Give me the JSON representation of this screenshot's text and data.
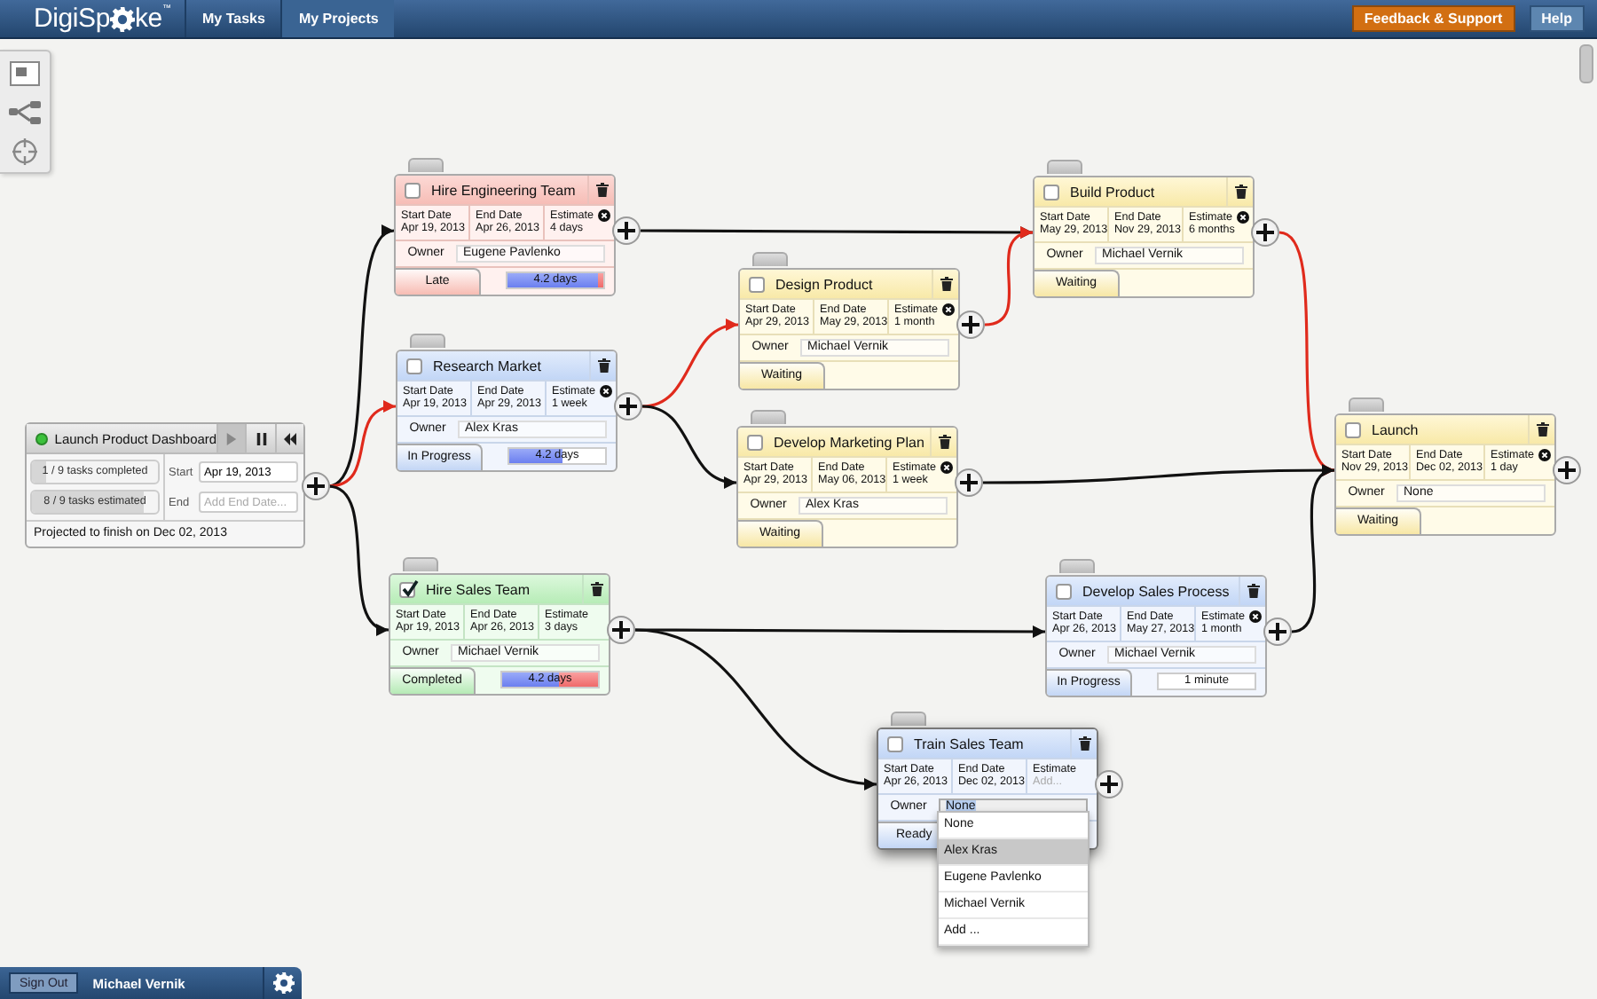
{
  "topbar": {
    "logo": {
      "parts": [
        "DigiSp",
        "ke"
      ],
      "mark": "™"
    },
    "tabs": [
      {
        "label": "My Tasks",
        "selected": false
      },
      {
        "label": "My Projects",
        "selected": true
      }
    ],
    "buttons": [
      {
        "label": "Feedback & Support",
        "kind": "feedback"
      },
      {
        "label": "Help",
        "kind": "help"
      }
    ]
  },
  "dashboard": {
    "title": "Launch Product Dashboard",
    "running": true,
    "controls": [
      {
        "kind": "play",
        "disabled": true
      },
      {
        "kind": "pause",
        "disabled": false
      },
      {
        "kind": "rewind",
        "disabled": false
      }
    ],
    "counters": [
      {
        "label": "1 / 9 tasks completed",
        "level": 0.11
      },
      {
        "label": "8 / 9 tasks estimated",
        "level": 0.89
      }
    ],
    "start": {
      "label": "Start",
      "value": "Apr 19, 2013"
    },
    "end": {
      "label": "End",
      "placeholder": "Add End Date..."
    },
    "projection": "Projected to finish on Dec 02, 2013",
    "links": [
      {
        "critical": false
      },
      {
        "critical": true
      },
      {
        "critical": false
      }
    ]
  },
  "tasks": [
    {
      "title": "Hire Engineering Team",
      "done": false,
      "focused": false,
      "dates": [
        {
          "label": "Start Date",
          "value": "Apr 19, 2013"
        },
        {
          "label": "End Date",
          "value": "Apr 26, 2013"
        },
        {
          "label": "Estimate",
          "value": "4 days",
          "clearable": true
        }
      ],
      "owner": {
        "label": "Owner",
        "value": "Eugene Pavlenko"
      },
      "status": {
        "label": "Late",
        "kind": "late"
      },
      "progress": {
        "label": "4.2 days",
        "level": 0.95,
        "overdue": true
      },
      "links": [
        {
          "critical": false
        }
      ]
    },
    {
      "title": "Research Market",
      "done": false,
      "focused": false,
      "dates": [
        {
          "label": "Start Date",
          "value": "Apr 19, 2013"
        },
        {
          "label": "End Date",
          "value": "Apr 29, 2013"
        },
        {
          "label": "Estimate",
          "value": "1 week",
          "clearable": true
        }
      ],
      "owner": {
        "label": "Owner",
        "value": "Alex Kras"
      },
      "status": {
        "label": "In Progress",
        "kind": "in-progress"
      },
      "progress": {
        "label": "4.2 days",
        "level": 0.55,
        "overdue": false
      },
      "links": [
        {
          "critical": true
        },
        {
          "critical": false
        }
      ]
    },
    {
      "title": "Hire Sales Team",
      "done": true,
      "focused": false,
      "dates": [
        {
          "label": "Start Date",
          "value": "Apr 19, 2013"
        },
        {
          "label": "End Date",
          "value": "Apr 26, 2013"
        },
        {
          "label": "Estimate",
          "value": "3 days",
          "clearable": false
        }
      ],
      "owner": {
        "label": "Owner",
        "value": "Michael Vernik"
      },
      "status": {
        "label": "Completed",
        "kind": "completed"
      },
      "progress": {
        "label": "4.2 days",
        "level": 0.6,
        "overdue": true
      },
      "links": [
        {
          "critical": false
        },
        {
          "critical": false
        }
      ]
    },
    {
      "title": "Design Product",
      "done": false,
      "focused": false,
      "dates": [
        {
          "label": "Start Date",
          "value": "Apr 29, 2013"
        },
        {
          "label": "End Date",
          "value": "May 29, 2013"
        },
        {
          "label": "Estimate",
          "value": "1 month",
          "clearable": true
        }
      ],
      "owner": {
        "label": "Owner",
        "value": "Michael Vernik"
      },
      "status": {
        "label": "Waiting",
        "kind": "waiting"
      },
      "links": [
        {
          "critical": true
        }
      ]
    },
    {
      "title": "Develop Marketing Plan",
      "done": false,
      "focused": false,
      "dates": [
        {
          "label": "Start Date",
          "value": "Apr 29, 2013"
        },
        {
          "label": "End Date",
          "value": "May 06, 2013"
        },
        {
          "label": "Estimate",
          "value": "1 week",
          "clearable": true
        }
      ],
      "owner": {
        "label": "Owner",
        "value": "Alex Kras"
      },
      "status": {
        "label": "Waiting",
        "kind": "waiting"
      },
      "links": [
        {
          "critical": false
        }
      ]
    },
    {
      "title": "Build Product",
      "done": false,
      "focused": false,
      "dates": [
        {
          "label": "Start Date",
          "value": "May 29, 2013"
        },
        {
          "label": "End Date",
          "value": "Nov 29, 2013"
        },
        {
          "label": "Estimate",
          "value": "6 months",
          "clearable": true
        }
      ],
      "owner": {
        "label": "Owner",
        "value": "Michael Vernik"
      },
      "status": {
        "label": "Waiting",
        "kind": "waiting"
      },
      "links": [
        {
          "critical": true
        }
      ]
    },
    {
      "title": "Launch",
      "done": false,
      "focused": false,
      "dates": [
        {
          "label": "Start Date",
          "value": "Nov 29, 2013"
        },
        {
          "label": "End Date",
          "value": "Dec 02, 2013"
        },
        {
          "label": "Estimate",
          "value": "1 day",
          "clearable": true
        }
      ],
      "owner": {
        "label": "Owner",
        "value": "None"
      },
      "status": {
        "label": "Waiting",
        "kind": "waiting"
      }
    },
    {
      "title": "Develop Sales Process",
      "done": false,
      "focused": false,
      "dates": [
        {
          "label": "Start Date",
          "value": "Apr 26, 2013"
        },
        {
          "label": "End Date",
          "value": "May 27, 2013"
        },
        {
          "label": "Estimate",
          "value": "1 month",
          "clearable": true
        }
      ],
      "owner": {
        "label": "Owner",
        "value": "Michael Vernik"
      },
      "status": {
        "label": "In Progress",
        "kind": "in-progress"
      },
      "progress": {
        "label": "1 minute",
        "level": 0,
        "overdue": false
      },
      "links": [
        {
          "critical": false
        }
      ]
    },
    {
      "title": "Train Sales Team",
      "done": false,
      "focused": true,
      "dates": [
        {
          "label": "Start Date",
          "value": "Apr 26, 2013"
        },
        {
          "label": "End Date",
          "value": "Dec 02, 2013"
        },
        {
          "label": "Estimate",
          "placeholder": "Add...",
          "clearable": false
        }
      ],
      "owner": {
        "label": "Owner",
        "value": "None"
      },
      "status": {
        "label": "Ready",
        "kind": "ready"
      },
      "owner_menu": {
        "options": [
          {
            "label": "None",
            "selected": false
          },
          {
            "label": "Alex Kras",
            "selected": true
          },
          {
            "label": "Eugene Pavlenko",
            "selected": false
          },
          {
            "label": "Michael Vernik",
            "selected": false
          },
          {
            "label": "Add ...",
            "selected": false
          }
        ]
      }
    }
  ],
  "user_bar": {
    "sign_out": "Sign Out",
    "user": "Michael Vernik"
  }
}
